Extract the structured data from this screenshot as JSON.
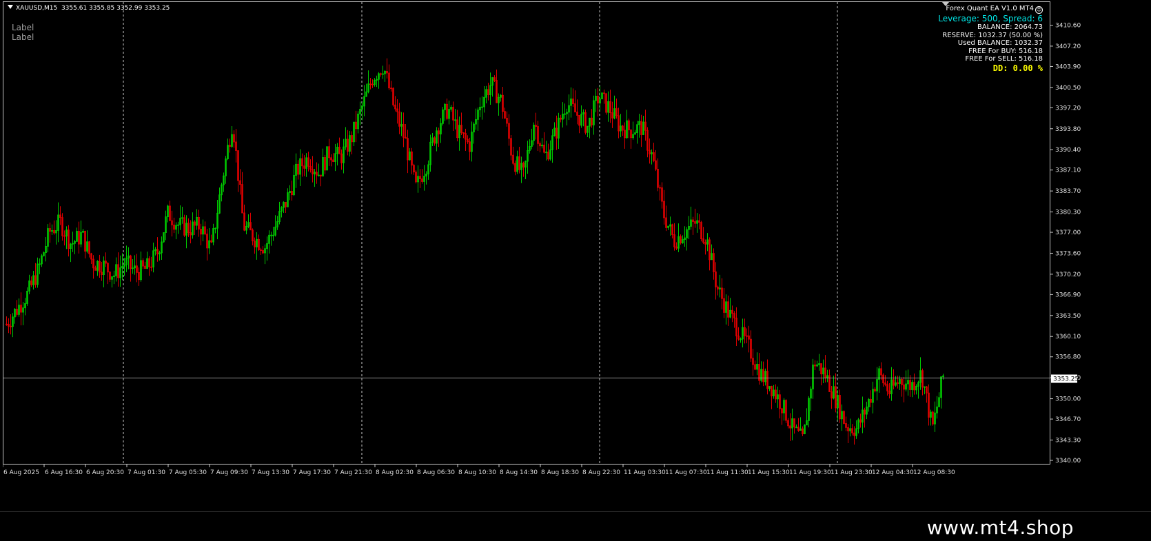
{
  "chart": {
    "symbol_label": "XAUUSD,M15",
    "ohlc_text": "3355.61 3355.85 3352.99 3353.25",
    "labels": [
      "Label",
      "Label"
    ],
    "current_price_label": "3353.25",
    "current_price": 3353.25
  },
  "ea_panel": {
    "title": "Forex Quant EA V1.0 MT4",
    "leverage": "Leverage: 500, Spread: 6",
    "balance": "BALANCE: 2064.73",
    "reserve": "RESERVE: 1032.37 (50.00 %)",
    "used_balance": "Used BALANCE: 1032.37",
    "free_buy": "FREE For BUY: 516.18",
    "free_sell": "FREE For SELL: 516.18",
    "dd": "DD:  0.00 %"
  },
  "footer": {
    "brand": "www.mt4.shop"
  },
  "colors": {
    "bull": "#00c800",
    "bear": "#e00000",
    "grid": "#c8c8c8",
    "price_line": "#c0c0c0",
    "accent_cyan": "#00e5e5",
    "dd_yellow": "#ffff00"
  },
  "chart_data": {
    "type": "candlestick",
    "symbol": "XAUUSD",
    "timeframe": "M15",
    "ylim": [
      3340.0,
      3412.0
    ],
    "y_ticks": [
      "3410.60",
      "3407.20",
      "3403.90",
      "3400.50",
      "3397.20",
      "3393.80",
      "3390.40",
      "3387.10",
      "3383.70",
      "3380.30",
      "3377.00",
      "3373.60",
      "3370.20",
      "3366.90",
      "3363.50",
      "3360.10",
      "3356.80",
      "3353.40",
      "3350.00",
      "3346.70",
      "3343.30",
      "3340.00"
    ],
    "x_ticks": [
      "6 Aug 2025",
      "6 Aug 16:30",
      "6 Aug 20:30",
      "7 Aug 01:30",
      "7 Aug 05:30",
      "7 Aug 09:30",
      "7 Aug 13:30",
      "7 Aug 17:30",
      "7 Aug 21:30",
      "8 Aug 02:30",
      "8 Aug 06:30",
      "8 Aug 10:30",
      "8 Aug 14:30",
      "8 Aug 18:30",
      "8 Aug 22:30",
      "11 Aug 03:30",
      "11 Aug 07:30",
      "11 Aug 11:30",
      "11 Aug 15:30",
      "11 Aug 19:30",
      "11 Aug 23:30",
      "12 Aug 04:30",
      "12 Aug 08:30"
    ],
    "candle_count": 454,
    "trend_closes": [
      3362.0,
      3364.5,
      3367.0,
      3371.0,
      3377.0,
      3378.5,
      3375.0,
      3376.5,
      3372.0,
      3371.5,
      3370.0,
      3372.0,
      3370.5,
      3371.0,
      3373.5,
      3380.0,
      3378.0,
      3377.5,
      3378.0,
      3374.0,
      3385.0,
      3395.0,
      3378.0,
      3376.0,
      3374.5,
      3378.0,
      3382.0,
      3387.0,
      3389.0,
      3386.5,
      3390.0,
      3389.0,
      3392.0,
      3397.0,
      3402.0,
      3404.0,
      3397.0,
      3392.0,
      3384.0,
      3388.0,
      3394.0,
      3397.0,
      3393.0,
      3391.0,
      3398.0,
      3401.0,
      3398.0,
      3389.0,
      3386.0,
      3395.0,
      3389.0,
      3393.0,
      3398.0,
      3396.0,
      3394.0,
      3399.0,
      3397.0,
      3394.0,
      3393.5,
      3394.0,
      3389.0,
      3380.0,
      3375.5,
      3377.0,
      3378.5,
      3376.0,
      3368.0,
      3364.0,
      3361.0,
      3358.0,
      3354.0,
      3352.0,
      3349.0,
      3345.0,
      3343.0,
      3356.0,
      3354.0,
      3350.0,
      3345.5,
      3345.0,
      3349.0,
      3354.0,
      3351.0,
      3353.0,
      3352.0,
      3354.0,
      3345.0,
      3353.5
    ]
  }
}
